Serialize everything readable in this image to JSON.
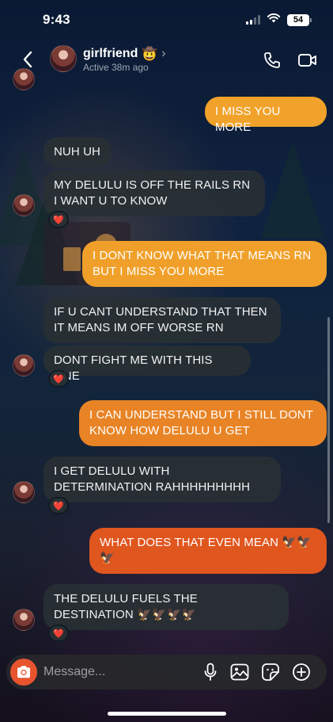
{
  "status_bar": {
    "time": "9:43",
    "battery": "54",
    "icons": [
      "cellular-signal-icon",
      "wifi-icon",
      "battery-icon"
    ]
  },
  "header": {
    "name": "girlfriend",
    "name_emoji": "🤠",
    "status": "Active 38m ago",
    "icons": [
      "chevron-left-icon",
      "chevron-right-icon",
      "phone-icon",
      "video-icon"
    ]
  },
  "messages": [
    {
      "dir": "out",
      "text": "I MISS YOU MORE"
    },
    {
      "dir": "in",
      "text": "NUH UH"
    },
    {
      "dir": "in",
      "text": "MY DELULU IS OFF THE RAILS RN I WANT U TO KNOW",
      "reaction": "❤️"
    },
    {
      "dir": "out",
      "text": "I DONT KNOW WHAT THAT MEANS RN BUT I MISS YOU MORE"
    },
    {
      "dir": "in",
      "text": "IF U CANT UNDERSTAND THAT THEN IT MEANS IM OFF WORSE RN"
    },
    {
      "dir": "in",
      "text": "DONT FIGHT ME WITH THIS ONE",
      "reaction": "❤️"
    },
    {
      "dir": "out",
      "text": "I CAN UNDERSTAND BUT I STILL DONT KNOW HOW DELULU U GET"
    },
    {
      "dir": "in",
      "text": "I GET DELULU WITH DETERMINATION RAHHHHHHHHH",
      "reaction": "❤️"
    },
    {
      "dir": "out",
      "text": "WHAT DOES THAT EVEN MEAN 🦅🦅🦅"
    },
    {
      "dir": "in",
      "text": "THE DELULU FUELS THE DESTINATION 🦅🦅🦅🦅",
      "reaction": "❤️"
    }
  ],
  "composer": {
    "placeholder": "Message...",
    "icons": [
      "camera-icon",
      "microphone-icon",
      "gallery-icon",
      "sticker-icon",
      "plus-icon"
    ]
  },
  "colors": {
    "out_bubble_top": "#f0a52a",
    "out_bubble_bottom": "#e0561f",
    "in_bubble": "#2a3034",
    "camera_button": "#e8542e"
  }
}
